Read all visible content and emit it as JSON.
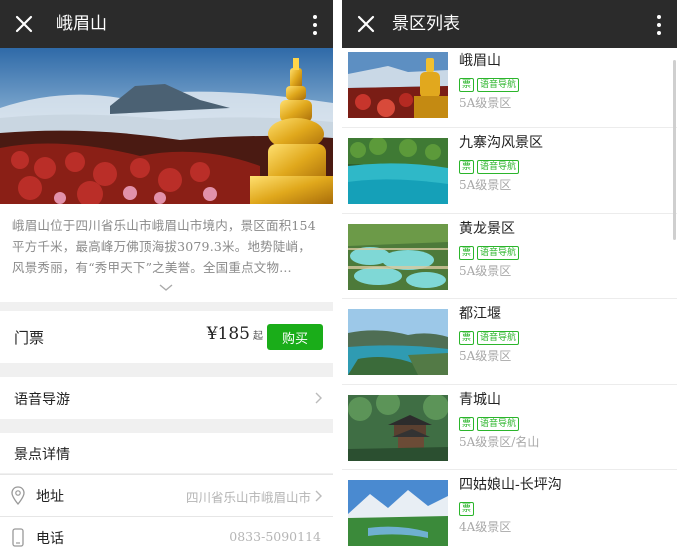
{
  "left": {
    "title": "峨眉山",
    "description": "峨眉山位于四川省乐山市峨眉山市境内，景区面积154平方千米，最高峰万佛顶海拔3079.3米。地势陡峭，风景秀丽，有“秀甲天下”之美誉。全国重点文物…",
    "ticket_label": "门票",
    "price": "¥185",
    "price_unit": "起",
    "buy_label": "购买",
    "audio_guide_label": "语音导游",
    "details_heading": "景点详情",
    "address_label": "地址",
    "address_value": "四川省乐山市峨眉山市",
    "phone_label": "电话",
    "phone_value": "0833-5090114"
  },
  "right": {
    "title": "景区列表",
    "items": [
      {
        "name": "峨眉山",
        "tags": [
          "票",
          "语音导航"
        ],
        "level": "5A级景区"
      },
      {
        "name": "九寨沟风景区",
        "tags": [
          "票",
          "语音导航"
        ],
        "level": "5A级景区"
      },
      {
        "name": "黄龙景区",
        "tags": [
          "票",
          "语音导航"
        ],
        "level": "5A级景区"
      },
      {
        "name": "都江堰",
        "tags": [
          "票",
          "语音导航"
        ],
        "level": "5A级景区"
      },
      {
        "name": "青城山",
        "tags": [
          "票",
          "语音导航"
        ],
        "level": "5A级景区/名山"
      },
      {
        "name": "四姑娘山-长坪沟",
        "tags": [
          "票"
        ],
        "level": "4A级景区"
      }
    ]
  },
  "colors": {
    "topbar": "#2b2b2b",
    "accent_green": "#1aad19",
    "tag_green": "#2bb52b"
  }
}
